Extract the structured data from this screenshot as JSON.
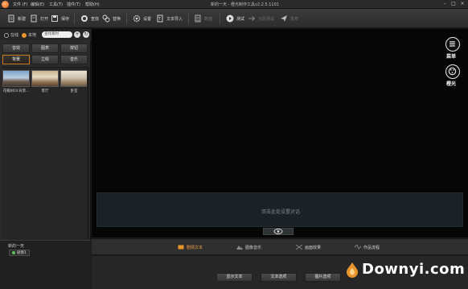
{
  "app": {
    "window_title": "新的一天 - 橙光制作工具v2.2.5.1101"
  },
  "menu": [
    "文件 (F)",
    "编辑(E)",
    "工具(T)",
    "插件(T)",
    "帮助(H)"
  ],
  "toolbar": {
    "new": "新建",
    "open": "打开",
    "save": "保存",
    "find": "查找",
    "replace": "替换",
    "settings": "设置",
    "text_import": "文本导入",
    "variables": "数值",
    "test": "测试",
    "partial_test": "分段测试",
    "publish": "发布"
  },
  "left": {
    "radio_online": "在线",
    "radio_local": "本地",
    "search_placeholder": "查找素材",
    "categories": [
      "音效",
      "图表",
      "按钮",
      "背景",
      "立绘",
      "音乐"
    ],
    "active_category": "背景",
    "thumbnails": [
      {
        "label": "花瓣树OL背景..."
      },
      {
        "label": "客厅"
      },
      {
        "label": "卧室"
      }
    ],
    "story_title": "新的一天",
    "scene_label": "剧情1"
  },
  "stage": {
    "menu_label": "菜单",
    "orange_label": "橙光",
    "dialog_placeholder": "双击此处设置对话"
  },
  "tabs": [
    "剧情文本",
    "图像音乐",
    "画面效果",
    "作品流程"
  ],
  "bottom_buttons": [
    "显示文本",
    "文本选项",
    "图片选项"
  ],
  "watermark": {
    "text": "Downyi.com"
  },
  "colors": {
    "accent": "#e8952c",
    "background": "#1b1b1b",
    "stage": "#060606"
  }
}
